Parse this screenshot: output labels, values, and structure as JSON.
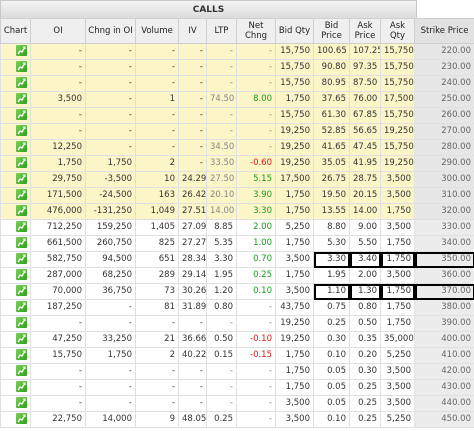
{
  "calls_label": "CALLS",
  "headers": {
    "chart": "Chart",
    "oi": "OI",
    "chng_oi": "Chng in OI",
    "volume": "Volume",
    "iv": "IV",
    "ltp": "LTP",
    "net_chng": "Net Chng",
    "bid_qty": "Bid Qty",
    "bid_price": "Bid Price",
    "ask_price": "Ask Price",
    "ask_qty": "Ask Qty",
    "strike": "Strike Price"
  },
  "icon": "chart-icon",
  "colors": {
    "itm": "#fbf5c8",
    "positive": "#1a9a1a",
    "negative": "#d01818"
  },
  "rows": [
    {
      "itm": true,
      "oi": "-",
      "chng_oi": "-",
      "volume": "-",
      "iv": "-",
      "ltp": "-",
      "net_chng": "-",
      "bid_qty": "15,750",
      "bid_price": "100.65",
      "ask_price": "107.25",
      "ask_qty": "15,750",
      "strike": "220.00"
    },
    {
      "itm": true,
      "oi": "-",
      "chng_oi": "-",
      "volume": "-",
      "iv": "-",
      "ltp": "-",
      "net_chng": "-",
      "bid_qty": "15,750",
      "bid_price": "90.80",
      "ask_price": "97.35",
      "ask_qty": "15,750",
      "strike": "230.00"
    },
    {
      "itm": true,
      "oi": "-",
      "chng_oi": "-",
      "volume": "-",
      "iv": "-",
      "ltp": "-",
      "net_chng": "-",
      "bid_qty": "15,750",
      "bid_price": "80.95",
      "ask_price": "87.50",
      "ask_qty": "15,750",
      "strike": "240.00"
    },
    {
      "itm": true,
      "oi": "3,500",
      "chng_oi": "-",
      "volume": "1",
      "iv": "-",
      "ltp": "74.50",
      "net_chng": "8.00",
      "net_sign": "pos",
      "bid_qty": "1,750",
      "bid_price": "37.65",
      "ask_price": "76.00",
      "ask_qty": "17,500",
      "strike": "250.00"
    },
    {
      "itm": true,
      "oi": "-",
      "chng_oi": "-",
      "volume": "-",
      "iv": "-",
      "ltp": "-",
      "net_chng": "-",
      "bid_qty": "15,750",
      "bid_price": "61.30",
      "ask_price": "67.85",
      "ask_qty": "15,750",
      "strike": "260.00"
    },
    {
      "itm": true,
      "oi": "-",
      "chng_oi": "-",
      "volume": "-",
      "iv": "-",
      "ltp": "-",
      "net_chng": "-",
      "bid_qty": "19,250",
      "bid_price": "52.85",
      "ask_price": "56.65",
      "ask_qty": "19,250",
      "strike": "270.00"
    },
    {
      "itm": true,
      "oi": "12,250",
      "chng_oi": "-",
      "volume": "-",
      "iv": "-",
      "ltp": "34.50",
      "net_chng": "-",
      "bid_qty": "19,250",
      "bid_price": "41.65",
      "ask_price": "47.45",
      "ask_qty": "15,750",
      "strike": "280.00"
    },
    {
      "itm": true,
      "oi": "1,750",
      "chng_oi": "1,750",
      "volume": "2",
      "iv": "-",
      "ltp": "33.50",
      "net_chng": "-0.60",
      "net_sign": "neg",
      "bid_qty": "19,250",
      "bid_price": "35.05",
      "ask_price": "41.95",
      "ask_qty": "19,250",
      "strike": "290.00"
    },
    {
      "itm": true,
      "oi": "29,750",
      "chng_oi": "-3,500",
      "volume": "10",
      "iv": "24.29",
      "ltp": "27.50",
      "net_chng": "5.15",
      "net_sign": "pos",
      "bid_qty": "17,500",
      "bid_price": "26.75",
      "ask_price": "28.75",
      "ask_qty": "3,500",
      "strike": "300.00"
    },
    {
      "itm": true,
      "oi": "171,500",
      "chng_oi": "-24,500",
      "volume": "163",
      "iv": "26.42",
      "ltp": "20.10",
      "net_chng": "3.90",
      "net_sign": "pos",
      "bid_qty": "1,750",
      "bid_price": "19.50",
      "ask_price": "20.15",
      "ask_qty": "3,500",
      "strike": "310.00"
    },
    {
      "itm": true,
      "oi": "476,000",
      "chng_oi": "-131,250",
      "volume": "1,049",
      "iv": "27.51",
      "ltp": "14.00",
      "net_chng": "3.30",
      "net_sign": "pos",
      "bid_qty": "1,750",
      "bid_price": "13.55",
      "ask_price": "14.00",
      "ask_qty": "1,750",
      "strike": "320.00"
    },
    {
      "itm": false,
      "oi": "712,250",
      "chng_oi": "159,250",
      "volume": "1,405",
      "iv": "27.09",
      "ltp": "8.85",
      "net_chng": "2.00",
      "net_sign": "pos",
      "bid_qty": "5,250",
      "bid_price": "8.80",
      "ask_price": "9.00",
      "ask_qty": "3,500",
      "strike": "330.00"
    },
    {
      "itm": false,
      "oi": "661,500",
      "chng_oi": "260,750",
      "volume": "825",
      "iv": "27.27",
      "ltp": "5.35",
      "net_chng": "1.00",
      "net_sign": "pos",
      "bid_qty": "1,750",
      "bid_price": "5.30",
      "ask_price": "5.50",
      "ask_qty": "1,750",
      "strike": "340.00"
    },
    {
      "itm": false,
      "boxed": true,
      "oi": "582,750",
      "chng_oi": "94,500",
      "volume": "651",
      "iv": "28.34",
      "ltp": "3.30",
      "net_chng": "0.70",
      "net_sign": "pos",
      "bid_qty": "3,500",
      "bid_price": "3.30",
      "ask_price": "3.40",
      "ask_qty": "1,750",
      "strike": "350.00"
    },
    {
      "itm": false,
      "oi": "287,000",
      "chng_oi": "68,250",
      "volume": "289",
      "iv": "29.14",
      "ltp": "1.95",
      "net_chng": "0.25",
      "net_sign": "pos",
      "bid_qty": "1,750",
      "bid_price": "1.95",
      "ask_price": "2.00",
      "ask_qty": "3,500",
      "strike": "360.00"
    },
    {
      "itm": false,
      "boxed": true,
      "oi": "70,000",
      "chng_oi": "36,750",
      "volume": "73",
      "iv": "30.26",
      "ltp": "1.20",
      "net_chng": "0.10",
      "net_sign": "pos",
      "bid_qty": "3,500",
      "bid_price": "1.10",
      "ask_price": "1.30",
      "ask_qty": "1,750",
      "strike": "370.00"
    },
    {
      "itm": false,
      "oi": "187,250",
      "chng_oi": "-",
      "volume": "81",
      "iv": "31.89",
      "ltp": "0.80",
      "net_chng": "-",
      "bid_qty": "43,750",
      "bid_price": "0.75",
      "ask_price": "0.80",
      "ask_qty": "1,750",
      "strike": "380.00"
    },
    {
      "itm": false,
      "oi": "-",
      "chng_oi": "-",
      "volume": "-",
      "iv": "-",
      "ltp": "-",
      "net_chng": "-",
      "bid_qty": "19,250",
      "bid_price": "0.25",
      "ask_price": "0.50",
      "ask_qty": "1,750",
      "strike": "390.00"
    },
    {
      "itm": false,
      "oi": "47,250",
      "chng_oi": "33,250",
      "volume": "21",
      "iv": "36.66",
      "ltp": "0.50",
      "net_chng": "-0.10",
      "net_sign": "neg",
      "bid_qty": "19,250",
      "bid_price": "0.30",
      "ask_price": "0.35",
      "ask_qty": "35,000",
      "strike": "400.00"
    },
    {
      "itm": false,
      "oi": "15,750",
      "chng_oi": "1,750",
      "volume": "2",
      "iv": "40.22",
      "ltp": "0.15",
      "net_chng": "-0.15",
      "net_sign": "neg",
      "bid_qty": "1,750",
      "bid_price": "0.10",
      "ask_price": "0.20",
      "ask_qty": "5,250",
      "strike": "410.00"
    },
    {
      "itm": false,
      "oi": "-",
      "chng_oi": "-",
      "volume": "-",
      "iv": "-",
      "ltp": "-",
      "net_chng": "-",
      "bid_qty": "1,750",
      "bid_price": "0.05",
      "ask_price": "0.30",
      "ask_qty": "3,500",
      "strike": "420.00"
    },
    {
      "itm": false,
      "oi": "-",
      "chng_oi": "-",
      "volume": "-",
      "iv": "-",
      "ltp": "-",
      "net_chng": "-",
      "bid_qty": "1,750",
      "bid_price": "0.05",
      "ask_price": "0.25",
      "ask_qty": "3,500",
      "strike": "430.00"
    },
    {
      "itm": false,
      "oi": "-",
      "chng_oi": "-",
      "volume": "-",
      "iv": "-",
      "ltp": "-",
      "net_chng": "-",
      "bid_qty": "3,500",
      "bid_price": "0.05",
      "ask_price": "0.25",
      "ask_qty": "3,500",
      "strike": "440.00"
    },
    {
      "itm": false,
      "oi": "22,750",
      "chng_oi": "14,000",
      "volume": "9",
      "iv": "48.05",
      "ltp": "0.25",
      "net_chng": "-",
      "bid_qty": "3,500",
      "bid_price": "0.10",
      "ask_price": "0.25",
      "ask_qty": "5,250",
      "strike": "450.00"
    }
  ]
}
